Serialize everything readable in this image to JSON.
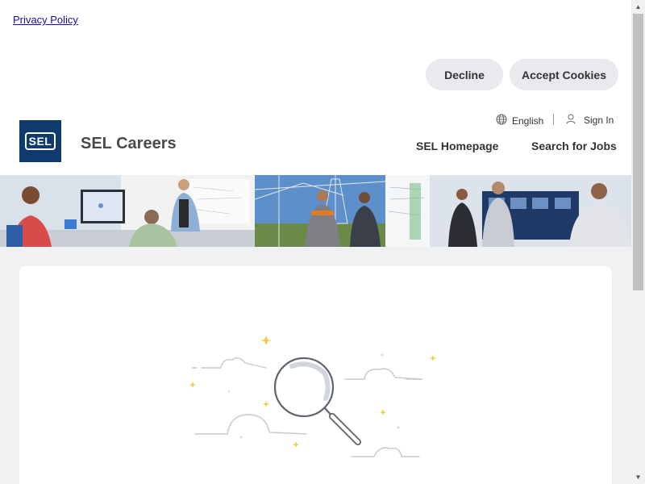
{
  "cookie_banner": {
    "privacy_link": "Privacy Policy",
    "decline_label": "Decline",
    "accept_label": "Accept Cookies"
  },
  "header": {
    "logo_text": "SEL",
    "brand": "SEL Careers",
    "language": "English",
    "sign_in": "Sign In",
    "nav": {
      "homepage": "SEL Homepage",
      "search_jobs": "Search for Jobs"
    }
  },
  "icons": {
    "globe": "globe-icon",
    "user": "user-icon",
    "magnifier": "magnifying-glass-illustration"
  },
  "colors": {
    "brand_navy": "#0e3b6c",
    "page_bg": "#f0f1f2",
    "button_bg": "#e8eaed",
    "sparkle": "#f5c842"
  }
}
